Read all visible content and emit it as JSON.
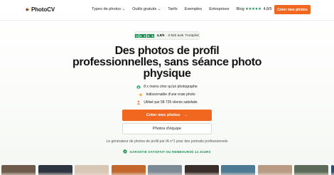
{
  "brand": {
    "name": "PhotoCV",
    "accent": "#f2671f",
    "trust_green": "#1f8e54"
  },
  "nav": {
    "links": [
      {
        "label": "Types de photos",
        "has_dropdown": true
      },
      {
        "label": "Outils gratuits",
        "has_dropdown": true
      },
      {
        "label": "Tarifs",
        "has_dropdown": false
      },
      {
        "label": "Exemples",
        "has_dropdown": false
      },
      {
        "label": "Entreprises",
        "has_dropdown": false
      },
      {
        "label": "Blog",
        "has_dropdown": false
      }
    ],
    "rating": {
      "stars": "★★★★★",
      "score": "4,8/5"
    },
    "cta_label": "Créer mes photos"
  },
  "hero": {
    "rating_pill": {
      "score": "4,8/5",
      "count": "· 3 522 avis",
      "provider": "Trustpilot"
    },
    "headline": "Des photos de profil professionnelles, sans séance photo physique",
    "features": [
      {
        "icon": "camera-icon",
        "text": "8 x moins cher qu'un photographe"
      },
      {
        "icon": "star-icon",
        "text": "Indiscernable d'une vraie photo"
      },
      {
        "icon": "users-icon",
        "text": "Utilisé par 58 725 clients satisfaits"
      }
    ],
    "primary_cta": "Créer mes photos",
    "primary_cta_arrow": "→",
    "secondary_cta": "Photos d'équipe",
    "subtext": "Le générateur de photos de profil par IA n°1 pour des portraits professionnels",
    "guarantee": "GARANTIE SATISFAIT OU REMBOURSÉ 14 JOURS"
  },
  "photo_strip": {
    "colors": [
      "#6f5a4c",
      "#2c3540",
      "#d9c7b5",
      "#c4672c",
      "#7c8a96",
      "#3a2e2a",
      "#4c7a92",
      "#b99a83",
      "#5f6b5a",
      "#2f4c6e",
      "#d6a38a"
    ]
  }
}
